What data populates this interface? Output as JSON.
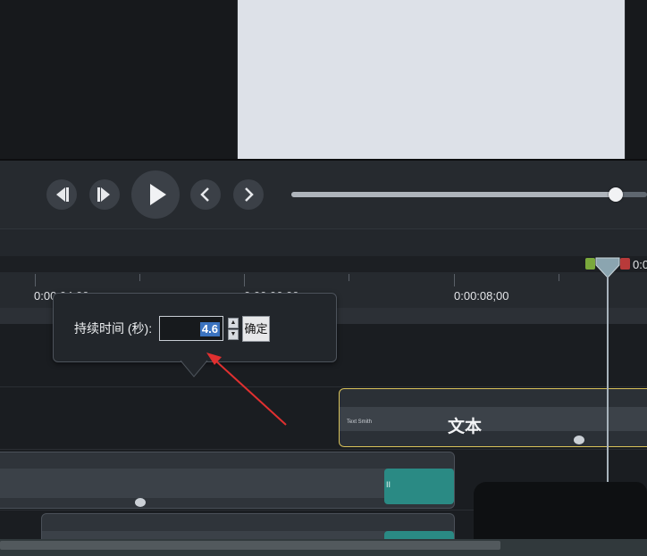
{
  "transport": {
    "buttons": [
      "step-back",
      "step-forward",
      "play",
      "previous-marker",
      "next-marker"
    ],
    "scrub_progress": 0.91
  },
  "ruler": {
    "labels": [
      "0:00:04;00",
      "0:00:06;00",
      "0:00:08;00"
    ],
    "playhead_time": "0:0"
  },
  "duration_popup": {
    "label": "持续时间 (秒):",
    "value": "4.6",
    "ok_label": "确定"
  },
  "tracks": {
    "text_clip_title": "文本",
    "text_clip_small": "Text Smith",
    "media_clip_marker": "II"
  },
  "colors": {
    "accent_selection": "#3b73c0",
    "clip_highlight": "#d9c25a",
    "teal_clip": "#2a8a84",
    "annotation_arrow": "#e03030"
  }
}
